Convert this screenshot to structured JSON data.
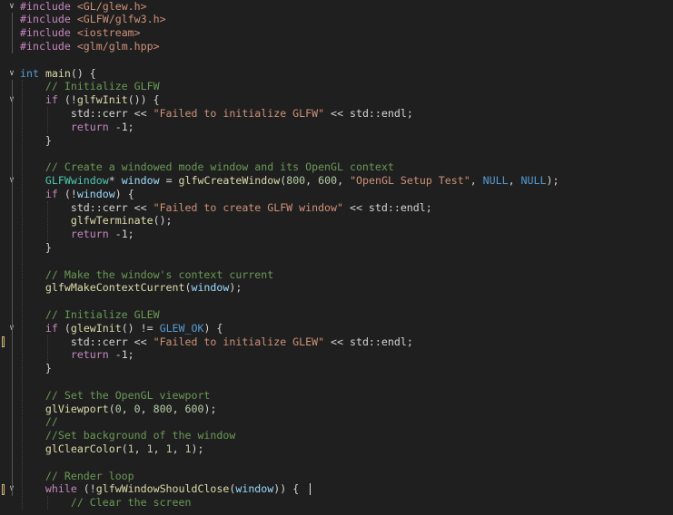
{
  "editor": {
    "lines": [
      [
        {
          "t": "#include ",
          "c": "pp"
        },
        {
          "t": "<GL/glew.h>",
          "c": "inc"
        }
      ],
      [
        {
          "t": "#include ",
          "c": "pp"
        },
        {
          "t": "<GLFW/glfw3.h>",
          "c": "inc"
        }
      ],
      [
        {
          "t": "#include ",
          "c": "pp"
        },
        {
          "t": "<iostream>",
          "c": "inc"
        }
      ],
      [
        {
          "t": "#include ",
          "c": "pp"
        },
        {
          "t": "<glm/glm.hpp>",
          "c": "inc"
        }
      ],
      [],
      [
        {
          "t": "int",
          "c": "kw"
        },
        {
          "t": " ",
          "c": "pl"
        },
        {
          "t": "main",
          "c": "fn"
        },
        {
          "t": "() {",
          "c": "pl"
        }
      ],
      [
        {
          "t": "    ",
          "c": "pl"
        },
        {
          "t": "// Initialize GLFW",
          "c": "cm"
        }
      ],
      [
        {
          "t": "    ",
          "c": "pl"
        },
        {
          "t": "if",
          "c": "ctrl"
        },
        {
          "t": " (!",
          "c": "pl"
        },
        {
          "t": "glfwInit",
          "c": "fn"
        },
        {
          "t": "()) {",
          "c": "pl"
        }
      ],
      [
        {
          "t": "        std::",
          "c": "pl"
        },
        {
          "t": "cerr",
          "c": "pl"
        },
        {
          "t": " << ",
          "c": "pl"
        },
        {
          "t": "\"Failed to initialize GLFW\"",
          "c": "str"
        },
        {
          "t": " << std::",
          "c": "pl"
        },
        {
          "t": "endl",
          "c": "pl"
        },
        {
          "t": ";",
          "c": "pl"
        }
      ],
      [
        {
          "t": "        ",
          "c": "pl"
        },
        {
          "t": "return",
          "c": "ctrl"
        },
        {
          "t": " -1;",
          "c": "pl"
        }
      ],
      [
        {
          "t": "    }",
          "c": "pl"
        }
      ],
      [],
      [
        {
          "t": "    ",
          "c": "pl"
        },
        {
          "t": "// Create a windowed mode window and its OpenGL context",
          "c": "cm"
        }
      ],
      [
        {
          "t": "    ",
          "c": "pl"
        },
        {
          "t": "GLFWwindow",
          "c": "type"
        },
        {
          "t": "* ",
          "c": "pl"
        },
        {
          "t": "window",
          "c": "var"
        },
        {
          "t": " = ",
          "c": "pl"
        },
        {
          "t": "glfwCreateWindow",
          "c": "fn"
        },
        {
          "t": "(",
          "c": "pl"
        },
        {
          "t": "800",
          "c": "num"
        },
        {
          "t": ", ",
          "c": "pl"
        },
        {
          "t": "600",
          "c": "num"
        },
        {
          "t": ", ",
          "c": "pl"
        },
        {
          "t": "\"OpenGL Setup Test\"",
          "c": "str"
        },
        {
          "t": ", ",
          "c": "pl"
        },
        {
          "t": "NULL",
          "c": "macro"
        },
        {
          "t": ", ",
          "c": "pl"
        },
        {
          "t": "NULL",
          "c": "macro"
        },
        {
          "t": ");",
          "c": "pl"
        }
      ],
      [
        {
          "t": "    ",
          "c": "pl"
        },
        {
          "t": "if",
          "c": "ctrl"
        },
        {
          "t": " (!",
          "c": "pl"
        },
        {
          "t": "window",
          "c": "var"
        },
        {
          "t": ") {",
          "c": "pl"
        }
      ],
      [
        {
          "t": "        std::",
          "c": "pl"
        },
        {
          "t": "cerr",
          "c": "pl"
        },
        {
          "t": " << ",
          "c": "pl"
        },
        {
          "t": "\"Failed to create GLFW window\"",
          "c": "str"
        },
        {
          "t": " << std::",
          "c": "pl"
        },
        {
          "t": "endl",
          "c": "pl"
        },
        {
          "t": ";",
          "c": "pl"
        }
      ],
      [
        {
          "t": "        ",
          "c": "pl"
        },
        {
          "t": "glfwTerminate",
          "c": "fn"
        },
        {
          "t": "();",
          "c": "pl"
        }
      ],
      [
        {
          "t": "        ",
          "c": "pl"
        },
        {
          "t": "return",
          "c": "ctrl"
        },
        {
          "t": " -1;",
          "c": "pl"
        }
      ],
      [
        {
          "t": "    }",
          "c": "pl"
        }
      ],
      [],
      [
        {
          "t": "    ",
          "c": "pl"
        },
        {
          "t": "// Make the window's context current",
          "c": "cm"
        }
      ],
      [
        {
          "t": "    ",
          "c": "pl"
        },
        {
          "t": "glfwMakeContextCurrent",
          "c": "fn"
        },
        {
          "t": "(",
          "c": "pl"
        },
        {
          "t": "window",
          "c": "var"
        },
        {
          "t": ");",
          "c": "pl"
        }
      ],
      [],
      [
        {
          "t": "    ",
          "c": "pl"
        },
        {
          "t": "// Initialize GLEW",
          "c": "cm"
        }
      ],
      [
        {
          "t": "    ",
          "c": "pl"
        },
        {
          "t": "if",
          "c": "ctrl"
        },
        {
          "t": " (",
          "c": "pl"
        },
        {
          "t": "glewInit",
          "c": "fn"
        },
        {
          "t": "() != ",
          "c": "pl"
        },
        {
          "t": "GLEW_OK",
          "c": "macro"
        },
        {
          "t": ") {",
          "c": "pl"
        }
      ],
      [
        {
          "t": "        std::",
          "c": "pl"
        },
        {
          "t": "cerr",
          "c": "pl"
        },
        {
          "t": " << ",
          "c": "pl"
        },
        {
          "t": "\"Failed to initialize GLEW\"",
          "c": "str"
        },
        {
          "t": " << std::",
          "c": "pl"
        },
        {
          "t": "endl",
          "c": "pl"
        },
        {
          "t": ";",
          "c": "pl"
        }
      ],
      [
        {
          "t": "        ",
          "c": "pl"
        },
        {
          "t": "return",
          "c": "ctrl"
        },
        {
          "t": " -1;",
          "c": "pl"
        }
      ],
      [
        {
          "t": "    }",
          "c": "pl"
        }
      ],
      [],
      [
        {
          "t": "    ",
          "c": "pl"
        },
        {
          "t": "// Set the OpenGL viewport",
          "c": "cm"
        }
      ],
      [
        {
          "t": "    ",
          "c": "pl"
        },
        {
          "t": "glViewport",
          "c": "fn"
        },
        {
          "t": "(",
          "c": "pl"
        },
        {
          "t": "0",
          "c": "num"
        },
        {
          "t": ", ",
          "c": "pl"
        },
        {
          "t": "0",
          "c": "num"
        },
        {
          "t": ", ",
          "c": "pl"
        },
        {
          "t": "800",
          "c": "num"
        },
        {
          "t": ", ",
          "c": "pl"
        },
        {
          "t": "600",
          "c": "num"
        },
        {
          "t": ");",
          "c": "pl"
        }
      ],
      [
        {
          "t": "    ",
          "c": "pl"
        },
        {
          "t": "//",
          "c": "cm"
        }
      ],
      [
        {
          "t": "    ",
          "c": "pl"
        },
        {
          "t": "//Set background of the window",
          "c": "cm"
        }
      ],
      [
        {
          "t": "    ",
          "c": "pl"
        },
        {
          "t": "glClearColor",
          "c": "fn"
        },
        {
          "t": "(",
          "c": "pl"
        },
        {
          "t": "1",
          "c": "num"
        },
        {
          "t": ", ",
          "c": "pl"
        },
        {
          "t": "1",
          "c": "num"
        },
        {
          "t": ", ",
          "c": "pl"
        },
        {
          "t": "1",
          "c": "num"
        },
        {
          "t": ", ",
          "c": "pl"
        },
        {
          "t": "1",
          "c": "num"
        },
        {
          "t": ");",
          "c": "pl"
        }
      ],
      [],
      [
        {
          "t": "    ",
          "c": "pl"
        },
        {
          "t": "// Render loop",
          "c": "cm"
        }
      ],
      [
        {
          "t": "    ",
          "c": "pl"
        },
        {
          "t": "while",
          "c": "ctrl"
        },
        {
          "t": " (!",
          "c": "pl"
        },
        {
          "t": "glfwWindowShouldClose",
          "c": "fn"
        },
        {
          "t": "(",
          "c": "pl"
        },
        {
          "t": "window",
          "c": "var"
        },
        {
          "t": ")) {",
          "c": "pl"
        }
      ],
      [
        {
          "t": "        ",
          "c": "pl"
        },
        {
          "t": "// Clear the screen",
          "c": "cm"
        }
      ]
    ],
    "fold_icons": [
      "chevron-down-icon",
      "chevron-down-icon",
      "chevron-down-icon",
      "chevron-down-icon",
      "chevron-down-icon",
      "chevron-down-icon"
    ],
    "colors": {
      "background": "#1f1f1f",
      "comment": "#6a9955",
      "string": "#ce9178",
      "keyword": "#569cd6",
      "control": "#c586c0",
      "function": "#dcdcaa",
      "type": "#4ec9b0",
      "variable": "#9cdcfe",
      "number": "#b5cea8",
      "plain": "#d4d4d4",
      "change_marker": "#d7ba7d"
    }
  }
}
